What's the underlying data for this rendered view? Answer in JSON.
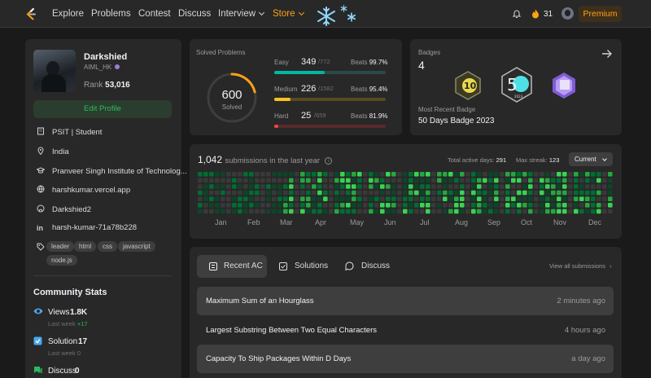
{
  "nav": {
    "links": [
      "Explore",
      "Problems",
      "Contest",
      "Discuss",
      "Interview",
      "Store"
    ],
    "streak_count": "31",
    "premium_label": "Premium",
    "accent_color": "#ffa116",
    "icons": [
      "leetcode-logo-icon",
      "snowflake-icon",
      "bell-icon",
      "fire-icon",
      "avatar"
    ]
  },
  "profile": {
    "username": "Darkshied",
    "handle": "AIML_HK",
    "rank_label": "Rank",
    "rank_value": "53,016",
    "edit_label": "Edit Profile",
    "info": [
      {
        "icon": "building-icon",
        "text": "PSIT | Student"
      },
      {
        "icon": "location-icon",
        "text": "India"
      },
      {
        "icon": "graduation-cap-icon",
        "text": "Pranveer Singh Institute of Technolog..."
      },
      {
        "icon": "globe-icon",
        "text": "harshkumar.vercel.app"
      },
      {
        "icon": "github-icon",
        "text": "Darkshied2"
      },
      {
        "icon": "linkedin-icon",
        "text": "harsh-kumar-71a78b228"
      }
    ],
    "tags": [
      "leader",
      "html",
      "css",
      "javascript",
      "node.js"
    ]
  },
  "community": {
    "title": "Community Stats",
    "stats": [
      {
        "icon": "eye-icon",
        "label": "Views",
        "value": "1.8K",
        "sub_label": "Last week",
        "sub_value": "+17"
      },
      {
        "icon": "checkbox-icon",
        "label": "Solution",
        "value": "17",
        "sub_label": "Last week",
        "sub_value": "0"
      },
      {
        "icon": "discuss-icon",
        "label": "Discuss",
        "value": "0"
      }
    ]
  },
  "solved": {
    "title": "Solved Problems",
    "total": "600",
    "total_label": "Solved",
    "progress_fraction": 0.21,
    "items": [
      {
        "label": "Easy",
        "count": "349",
        "total": "/772",
        "beats": "99.7%",
        "fraction": 0.452,
        "color": "#00b8a3",
        "bg": "#2a4a45"
      },
      {
        "label": "Medium",
        "count": "226",
        "total": "/1582",
        "beats": "95.4%",
        "fraction": 0.143,
        "color": "#ffc01e",
        "bg": "#5a4a21"
      },
      {
        "label": "Hard",
        "count": "25",
        "total": "/659",
        "beats": "81.9%",
        "fraction": 0.038,
        "color": "#ef4743",
        "bg": "#5a2a2a"
      }
    ],
    "beats_label": "Beats"
  },
  "badges": {
    "title": "Badges",
    "count": "4",
    "recent_label": "Most Recent Badge",
    "recent_name": "50 Days Badge 2023",
    "icons": [
      "100-days-badge-icon",
      "50-days-badge-icon",
      "annual-badge-icon"
    ]
  },
  "submissions": {
    "count": "1,042",
    "text": "submissions in the last year",
    "active_label": "Total active days:",
    "active_value": "291",
    "streak_label": "Max streak:",
    "streak_value": "123",
    "select_value": "Current",
    "months": [
      "Jan",
      "Feb",
      "Mar",
      "Apr",
      "May",
      "Jun",
      "Jul",
      "Aug",
      "Sep",
      "Oct",
      "Nov",
      "Dec"
    ]
  },
  "recent": {
    "tabs": [
      {
        "icon": "list-icon",
        "label": "Recent AC"
      },
      {
        "icon": "check-square-icon",
        "label": "Solutions"
      },
      {
        "icon": "chat-icon",
        "label": "Discuss"
      }
    ],
    "view_all": "View all submissions",
    "items": [
      {
        "title": "Maximum Sum of an Hourglass",
        "time": "2 minutes ago"
      },
      {
        "title": "Largest Substring Between Two Equal Characters",
        "time": "4 hours ago"
      },
      {
        "title": "Capacity To Ship Packages Within D Days",
        "time": "a day ago"
      }
    ]
  }
}
